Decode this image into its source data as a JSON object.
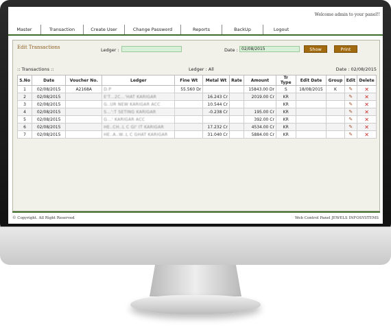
{
  "header": {
    "welcome": "Welcome admin to your panel!!"
  },
  "menu": [
    "Master",
    "Transaction",
    "Create User",
    "Change Password",
    "Reports",
    "BackUp",
    "Logout"
  ],
  "form": {
    "title": "Edit Transactions",
    "ledger_label": "Ledger :",
    "ledger_value": "",
    "date_label": "Date :",
    "date_value": "02/08/2015",
    "show_button": "Show",
    "print_button": "Print"
  },
  "info": {
    "transactions": ":: Transactions ::",
    "ledger": "Ledger :  All",
    "date": "Date : 02/08/2015"
  },
  "table": {
    "headers": [
      "S.No",
      "Date",
      "Voucher No.",
      "Ledger",
      "Fine Wt",
      "Metal Wt",
      "Rate",
      "Amount",
      "Tr Type",
      "Edit Date",
      "Group",
      "Edit",
      "Delete"
    ],
    "rows": [
      [
        "1",
        "02/08/2015",
        "A2168A",
        "D.P",
        "55.560 Dr",
        "",
        "",
        "15843.00 Dr",
        "S",
        "18/08/2015",
        "K"
      ],
      [
        "2",
        "02/08/2015",
        "",
        "E'T...2C...'HAT KARIGAR",
        "",
        "16.243 Cr",
        "",
        "2019.00 Cr",
        "KR",
        "",
        ""
      ],
      [
        "3",
        "02/08/2015",
        "",
        "G..UR NEW KARIGAR ACC",
        "",
        "10.544 Cr",
        "",
        "",
        "KR",
        "",
        ""
      ],
      [
        "4",
        "02/08/2015",
        "",
        "S...':T SETING KARIGAR",
        "",
        "-0.238 Cr",
        "",
        "195.00 Cr",
        "KR",
        "",
        ""
      ],
      [
        "5",
        "02/08/2015",
        "",
        "G...' KARIGAR ACC",
        "",
        "",
        "",
        "392.00 Cr",
        "KR",
        "",
        ""
      ],
      [
        "6",
        "02/08/2015",
        "",
        "HE..CH..L C GI' IT KARIGAR",
        "",
        "17.232 Cr",
        "",
        "4534.00 Cr",
        "KR",
        "",
        ""
      ],
      [
        "7",
        "02/08/2015",
        "",
        "HE..A..W..L C GHAT KARIGAR",
        "",
        "31.040 Cr",
        "",
        "5884.00 Cr",
        "KR",
        "",
        ""
      ]
    ]
  },
  "footer": {
    "copyright": "© Copyright. All Right Reserved",
    "credit": "Web Control Panel JEWELS INFOSYSTEMS"
  }
}
